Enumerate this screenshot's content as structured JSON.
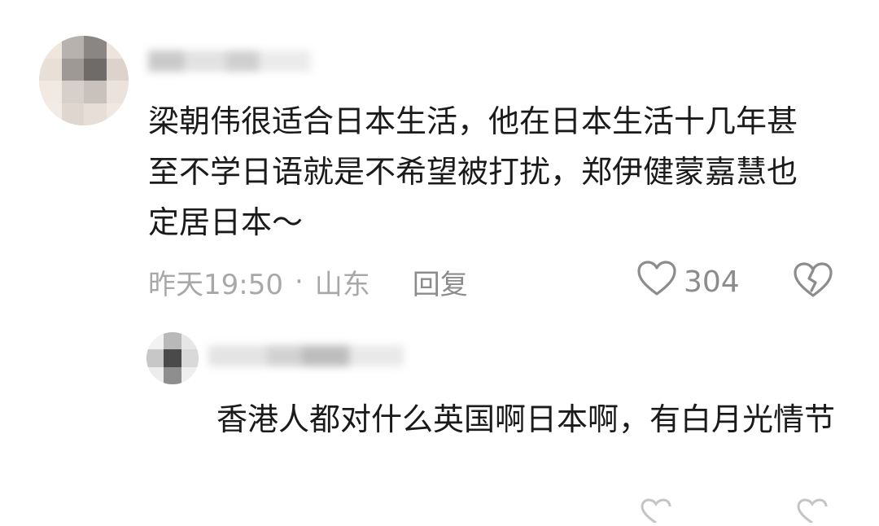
{
  "comment": {
    "text": "梁朝伟很适合日本生活，他在日本生活十几年甚至不学日语就是不希望被打扰，郑伊健蒙嘉慧也定居日本～",
    "time": "昨天19:50",
    "separator": "·",
    "location": "山东",
    "reply_label": "回复",
    "likes": "304",
    "like_icon": "heart-outline-icon",
    "dislike_icon": "broken-heart-icon"
  },
  "reply": {
    "text": "香港人都对什么英国啊日本啊，有白月光情节"
  },
  "colors": {
    "meta_text": "#a8a8a8",
    "icon": "#8c8c8c",
    "body_text": "#1a1a1a"
  }
}
